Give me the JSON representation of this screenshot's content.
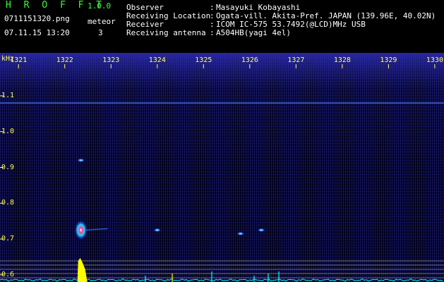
{
  "app": {
    "title": "H R O F F T",
    "version": "1.0.0",
    "file_name": "0711151320.png",
    "date_time": "07.11.15 13:20",
    "meteor_label": "meteor",
    "meteor_count": "3"
  },
  "info": [
    {
      "label": "Observer",
      "value": "Masayuki Kobayashi"
    },
    {
      "label": "Receiving Location",
      "value": "Ogata-vill. Akita-Pref. JAPAN (139.96E, 40.02N)"
    },
    {
      "label": "Receiver",
      "value": "ICOM IC-575 53.7492(@LCD)MHz USB"
    },
    {
      "label": "Receiving antenna",
      "value": "A504HB(yagi 4el)"
    }
  ],
  "colors": {
    "title_green": "#39ff3a",
    "axis_yellow": "#ffff55",
    "trace_cyan": "#00ffff",
    "carrier_blue": "#4a7bff",
    "meteor_yellow": "#ffff00"
  },
  "chart_data": {
    "type": "heatmap",
    "ylabel": "kHz",
    "x_ticks": [
      "1321",
      "1322",
      "1323",
      "1324",
      "1325",
      "1326",
      "1327",
      "1328",
      "1329",
      "1330"
    ],
    "y_ticks": [
      "1.1",
      "1.0",
      "0.9",
      "0.8",
      "0.7",
      "0.6"
    ],
    "xlim": [
      1320.6,
      1330.2
    ],
    "ylim": [
      0.58,
      1.22
    ],
    "carrier_line_khz": 1.08,
    "meteor_echoes": [
      {
        "time": 1322.35,
        "khz": 0.725,
        "strength": "strong"
      },
      {
        "time": 1322.35,
        "khz": 0.92,
        "strength": "weak"
      },
      {
        "time": 1324.0,
        "khz": 0.725,
        "strength": "weak"
      },
      {
        "time": 1325.8,
        "khz": 0.715,
        "strength": "weak"
      },
      {
        "time": 1326.25,
        "khz": 0.725,
        "strength": "weak"
      }
    ],
    "reference_lines": 5
  }
}
